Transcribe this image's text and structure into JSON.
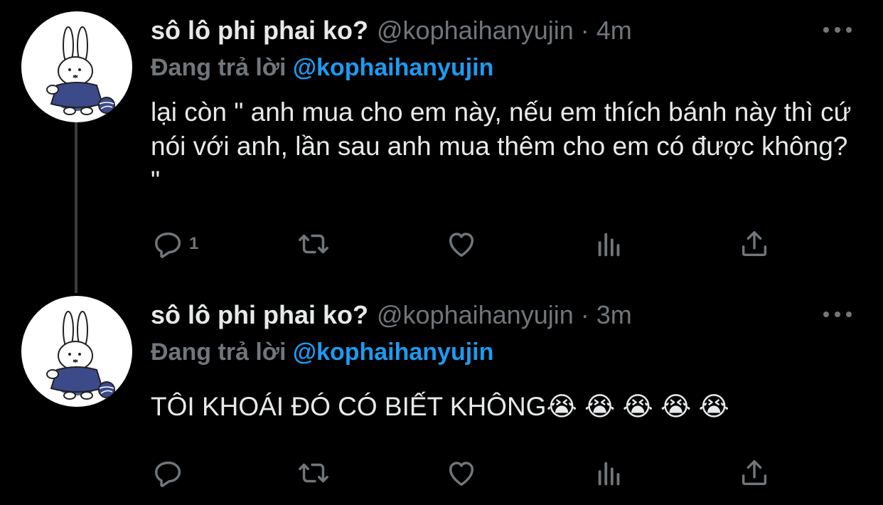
{
  "colors": {
    "background": "#000000",
    "primary_text": "#e7e9ea",
    "secondary_text": "#71767b",
    "mention": "#1d9bf0",
    "thread_line": "#3a3d40"
  },
  "tweets": [
    {
      "display_name": "sô lô phi phai ko?",
      "handle": "@kophaihanyujin",
      "separator": "·",
      "time": "4m",
      "replying_prefix": "Đang trả lời",
      "replying_to": "@kophaihanyujin",
      "text": "lại còn \" anh mua cho em này, nếu em thích bánh này thì cứ nói với anh, lần sau anh mua thêm cho em có được không? \"",
      "reply_count": "1",
      "icons": [
        "reply-icon",
        "retweet-icon",
        "like-icon",
        "stats-icon",
        "share-icon",
        "more-icon"
      ]
    },
    {
      "display_name": "sô lô phi phai ko?",
      "handle": "@kophaihanyujin",
      "separator": "·",
      "time": "3m",
      "replying_prefix": "Đang trả lời",
      "replying_to": "@kophaihanyujin",
      "text": "TÔI KHOÁI ĐÓ CÓ BIẾT KHÔNG😭 😭 😭 😭 😭",
      "reply_count": "",
      "icons": [
        "reply-icon",
        "retweet-icon",
        "like-icon",
        "stats-icon",
        "share-icon",
        "more-icon"
      ]
    }
  ]
}
